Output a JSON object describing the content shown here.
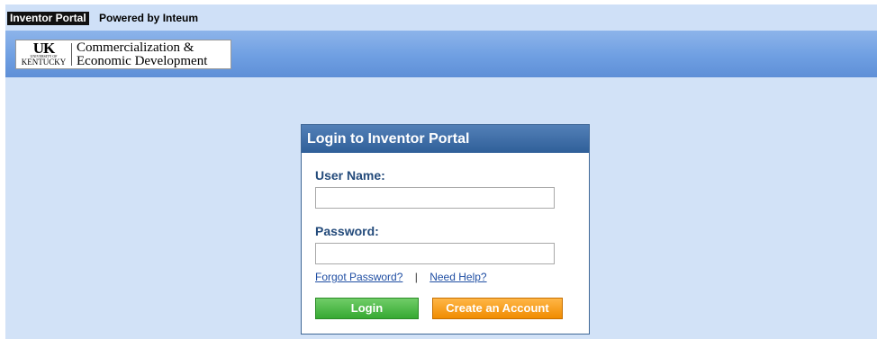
{
  "header": {
    "portal_name": "Inventor Portal",
    "powered_by": "Powered by Inteum"
  },
  "logo": {
    "uk_letters": "UK",
    "uk_small": "UNIVERSITY OF",
    "uk_state": "KENTUCKY",
    "line1": "Commercialization &",
    "line2": "Economic Development"
  },
  "login": {
    "title": "Login to Inventor Portal",
    "username_label": "User Name:",
    "username_value": "",
    "password_label": "Password:",
    "password_value": "",
    "forgot_password": "Forgot Password?",
    "separator": "|",
    "need_help": "Need Help?",
    "login_button": "Login",
    "create_account_button": "Create an Account"
  },
  "colors": {
    "header_blue": "#2f5f99",
    "label_blue": "#244b7b",
    "login_green": "#36a932",
    "create_orange": "#f08c00",
    "background_light_blue": "#d2e2f7"
  }
}
